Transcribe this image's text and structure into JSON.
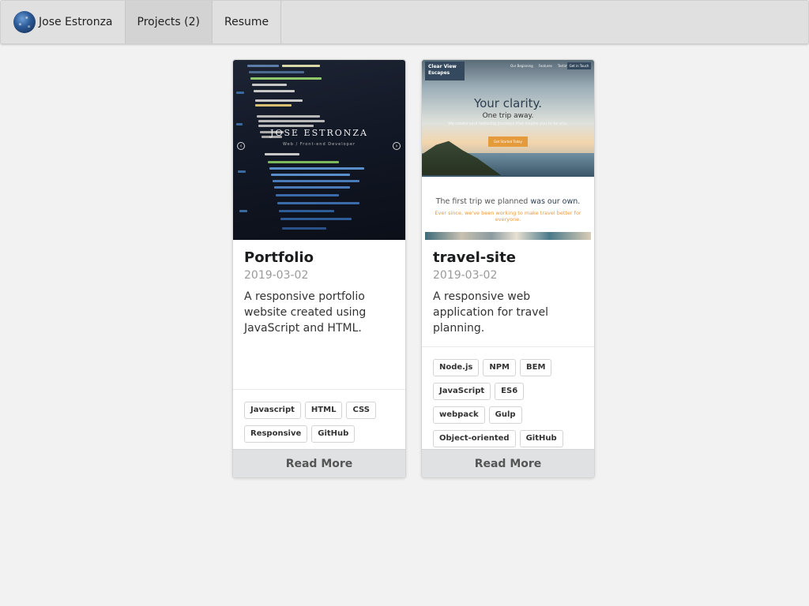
{
  "menu": {
    "brand_name": "Jose Estronza",
    "projects_label": "Projects (2)",
    "resume_label": "Resume"
  },
  "cards": [
    {
      "title": "Portfolio",
      "date": "2019-03-02",
      "description": "A responsive portfolio website created using JavaScript and HTML.",
      "tags": [
        "Javascript",
        "HTML",
        "CSS",
        "Responsive",
        "GitHub"
      ],
      "button": "Read More",
      "screenshot": {
        "overlay_title": "JOSE ESTRONZA",
        "overlay_subtitle": "Web / Front-end Developer"
      }
    },
    {
      "title": "travel-site",
      "date": "2019-03-02",
      "description": "A responsive web application for travel planning.",
      "tags": [
        "Node.js",
        "NPM",
        "BEM",
        "JavaScript",
        "ES6",
        "webpack",
        "Gulp",
        "Object-oriented",
        "GitHub"
      ],
      "button": "Read More",
      "screenshot": {
        "logo": "Clear View Escapes",
        "nav": [
          "Our Beginning",
          "Features",
          "Testimonials"
        ],
        "nav_cta": "Get in Touch",
        "hero_title": "Your clarity.",
        "hero_subtitle": "One trip away.",
        "hero_text": "We create soul restoring journeys that inspire you to be you.",
        "hero_button": "Get Started Today",
        "section_title_start": "The first trip we planned",
        "section_title_end": "was our own.",
        "section_text": "Ever since, we've been working to make travel better for everyone."
      }
    }
  ],
  "colors": {
    "menu_bg": "#e0e0e0",
    "active_menu_bg": "#d3d3d3",
    "page_bg": "#f2f2f2",
    "button_bg": "#e0e1e2",
    "travel_accent": "#e59a3c",
    "travel_dark": "#34495e"
  }
}
